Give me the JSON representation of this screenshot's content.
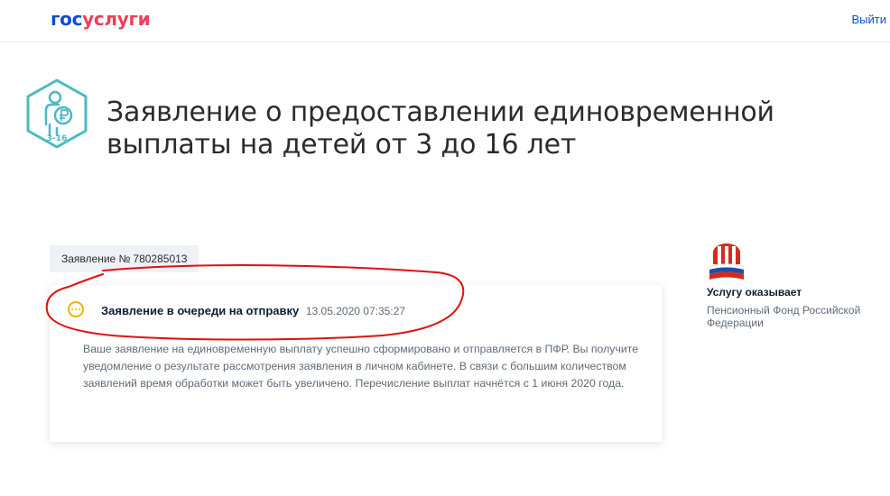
{
  "header": {
    "logo_part1": "гос",
    "logo_part2": "услуги",
    "logout_label": "Выйти"
  },
  "service": {
    "icon_caption": "3-16",
    "title": "Заявление о предоставлении единовременной выплаты на детей от 3 до 16 лет"
  },
  "application": {
    "label": "Заявление №",
    "number": "780285013"
  },
  "status": {
    "title": "Заявление в очереди на отправку",
    "datetime": "13.05.2020 07:35:27",
    "message": "Ваше заявление на единовременную выплату успешно сформировано и отправляется в ПФР. Вы получите уведомление о результате рассмотрения заявления в личном кабинете. В связи с большим количеством заявлений время обработки может быть увеличено. Перечисление выплат начнётся с 1 июня 2020 года."
  },
  "provider": {
    "label": "Услугу оказывает",
    "name": "Пенсионный Фонд Российской Федерации"
  },
  "colors": {
    "brand_blue": "#0d4cd3",
    "brand_red": "#ee3f58",
    "status_pending": "#f0b400",
    "icon_teal": "#4cb8c4",
    "annotation_red": "#e01010"
  }
}
